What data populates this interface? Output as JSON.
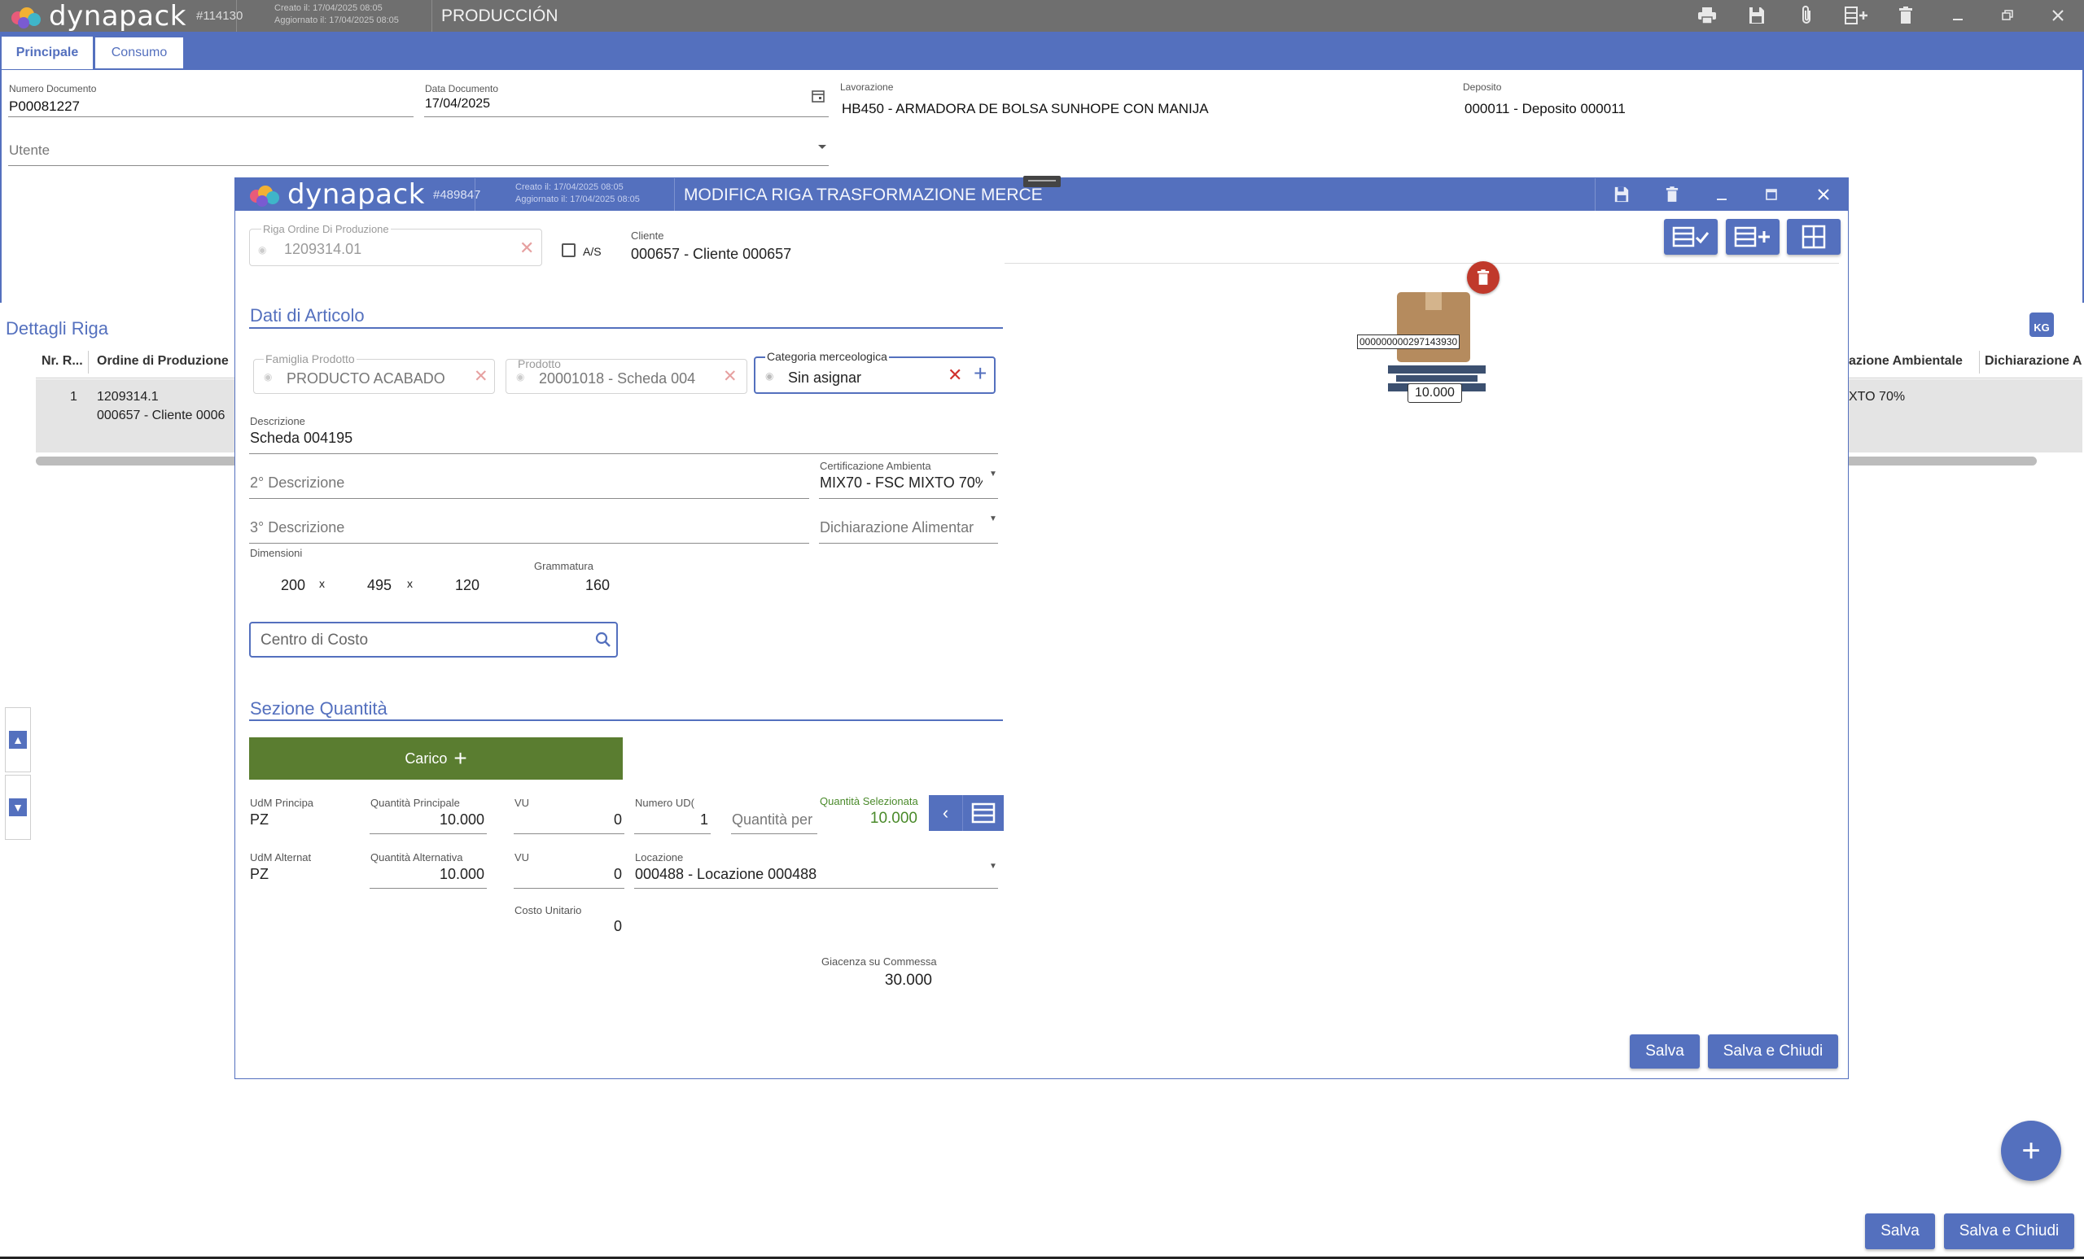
{
  "main": {
    "app_name": "dynapack",
    "doc_id": "#114130",
    "created": "Creato il: 17/04/2025 08:05",
    "updated": "Aggiornato il: 17/04/2025 08:05",
    "window_title": "PRODUCCIÓN",
    "tabs": [
      "Principale",
      "Consumo"
    ],
    "fields": {
      "numero_label": "Numero Documento",
      "numero_value": "P00081227",
      "data_label": "Data Documento",
      "data_value": "17/04/2025",
      "lavorazione_label": "Lavorazione",
      "lavorazione_value": "HB450 - ARMADORA DE BOLSA SUNHOPE CON MANIJA",
      "deposito_label": "Deposito",
      "deposito_value": "000011 - Deposito 000011",
      "utente_placeholder": "Utente"
    },
    "dettagli_title": "Dettagli Riga",
    "table": {
      "headers_left": [
        "Nr. R...",
        "Ordine di Produzione"
      ],
      "headers_right": [
        "azione Ambientale",
        "Dichiarazione A"
      ],
      "row": {
        "nr": "1",
        "ordine_line1": "1209314.1",
        "ordine_line2": "000657 - Cliente 0006",
        "right_value": "XTO 70%"
      }
    },
    "kg_label": "KG",
    "fab_label": "+",
    "save_label": "Salva",
    "save_close_label": "Salva e Chiudi"
  },
  "modal": {
    "app_name": "dynapack",
    "doc_id": "#489847",
    "created": "Creato il: 17/04/2025 08:05",
    "updated": "Aggiornato il: 17/04/2025 08:05",
    "title": "MODIFICA RIGA TRASFORMAZIONE MERCE",
    "riga_label": "Riga Ordine Di Produzione",
    "riga_value": "1209314.01",
    "as_label": "A/S",
    "cliente_label": "Cliente",
    "cliente_value": "000657 - Cliente 000657",
    "dati_title": "Dati di Articolo",
    "famiglia_label": "Famiglia Prodotto",
    "famiglia_value": "PRODUCTO ACABADO",
    "prodotto_label": "Prodotto",
    "prodotto_value": "20001018 - Scheda 004",
    "categoria_label": "Categoria merceologica",
    "categoria_value": "Sin asignar",
    "descrizione_label": "Descrizione",
    "descrizione_value": "Scheda 004195",
    "descr2_placeholder": "2° Descrizione",
    "cert_label": "Certificazione Ambienta",
    "cert_value": "MIX70 - FSC MIXTO 70%",
    "descr3_placeholder": "3° Descrizione",
    "dich_placeholder": "Dichiarazione Alimentar",
    "dimensioni_label": "Dimensioni",
    "dim": [
      "200",
      "495",
      "120"
    ],
    "dim_sep": "x",
    "grammatura_label": "Grammatura",
    "grammatura_value": "160",
    "centro_placeholder": "Centro di Costo",
    "quantita_title": "Sezione Quantità",
    "carico_label": "Carico",
    "udm_p_label": "UdM Principa",
    "udm_p_value": "PZ",
    "qta_p_label": "Quantità Principale",
    "qta_p_value": "10.000",
    "vu1_label": "VU",
    "vu1_value": "0",
    "numero_udc_label": "Numero UD(",
    "numero_udc_value": "1",
    "qta_per_placeholder": "Quantità per",
    "qta_sel_label": "Quantità Selezionata",
    "qta_sel_value": "10.000",
    "udm_a_label": "UdM Alternat",
    "udm_a_value": "PZ",
    "qta_a_label": "Quantità Alternativa",
    "qta_a_value": "10.000",
    "vu2_label": "VU",
    "vu2_value": "0",
    "locazione_label": "Locazione",
    "locazione_value": "000488 - Locazione 000488",
    "costo_label": "Costo Unitario",
    "costo_value": "0",
    "giacenza_label": "Giacenza su Commessa",
    "giacenza_value": "30.000",
    "pallet_barcode": "000000000297143930",
    "pallet_qty": "10.000",
    "save_label": "Salva",
    "save_close_label": "Salva e Chiudi"
  },
  "colors": {
    "accent": "#5470be",
    "titlebar": "#6f6f6f",
    "carico": "#5a7d30",
    "delete": "#c0392b",
    "selected_qty": "#4a8a2a"
  }
}
